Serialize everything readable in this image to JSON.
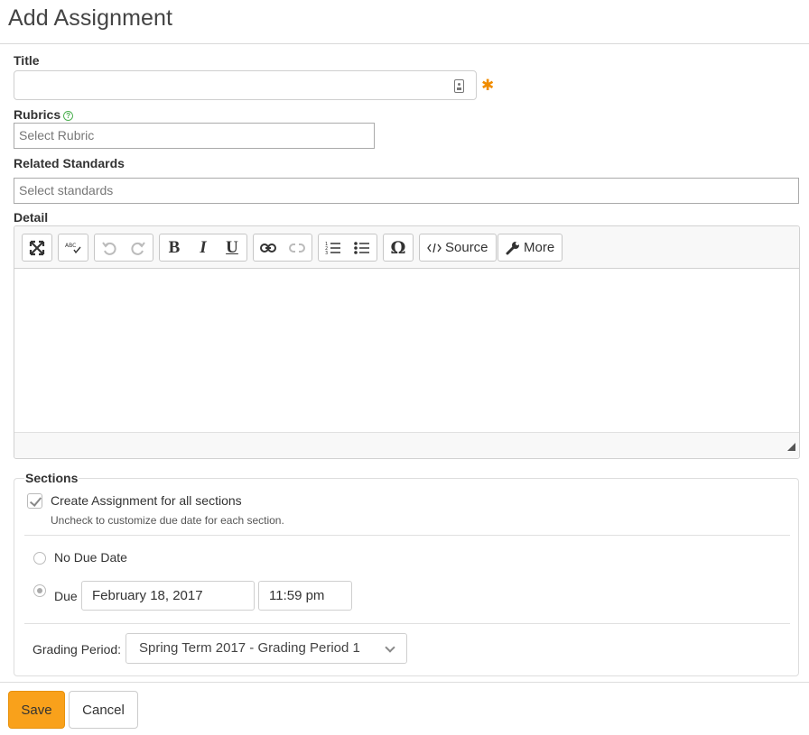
{
  "page": {
    "title": "Add Assignment"
  },
  "form": {
    "title_label": "Title",
    "title_value": "",
    "required_mark": "✱",
    "rubrics_label": "Rubrics",
    "rubrics_placeholder": "Select Rubric",
    "standards_label": "Related Standards",
    "standards_placeholder": "Select standards",
    "detail_label": "Detail"
  },
  "toolbar": {
    "source_label": "Source",
    "more_label": "More"
  },
  "sections": {
    "legend": "Sections",
    "all_sections_label": "Create Assignment for all sections",
    "all_sections_checked": true,
    "all_sections_help": "Uncheck to customize due date for each section.",
    "no_due_label": "No Due Date",
    "due_label": "Due",
    "due_date": "February 18, 2017",
    "due_time": "11:59 pm",
    "grading_label": "Grading Period:",
    "grading_value": "Spring Term 2017 - Grading Period 1"
  },
  "actions": {
    "save_label": "Save",
    "cancel_label": "Cancel"
  },
  "colors": {
    "accent": "#f9a11b",
    "required": "#f08c00",
    "help": "#4caf50"
  }
}
